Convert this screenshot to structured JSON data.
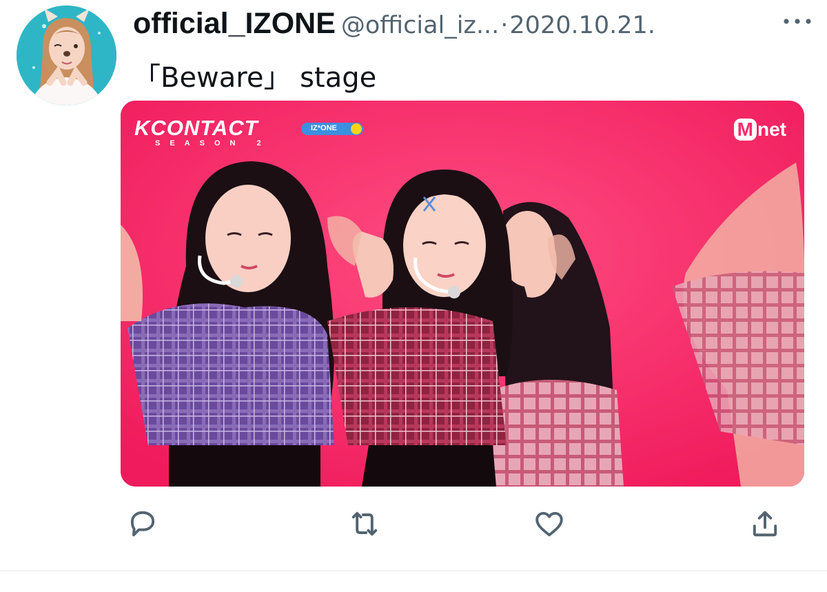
{
  "tweet": {
    "display_name": "official_IZONE",
    "handle": "@official_iz...",
    "separator": "·",
    "date": "2020.10.21.",
    "text": "「Beware」 stage",
    "more_icon": "more-horizontal-icon"
  },
  "media": {
    "show_logo": "KCONTACT",
    "show_season": "SEASON 2",
    "group_badge": "IZ*ONE",
    "channel_logo_m": "M",
    "channel_logo_rest": "net",
    "background_color": "#ff2c6e"
  },
  "actions": {
    "reply_icon": "reply-icon",
    "retweet_icon": "retweet-icon",
    "like_icon": "heart-icon",
    "share_icon": "share-icon",
    "icon_color": "#536471"
  }
}
